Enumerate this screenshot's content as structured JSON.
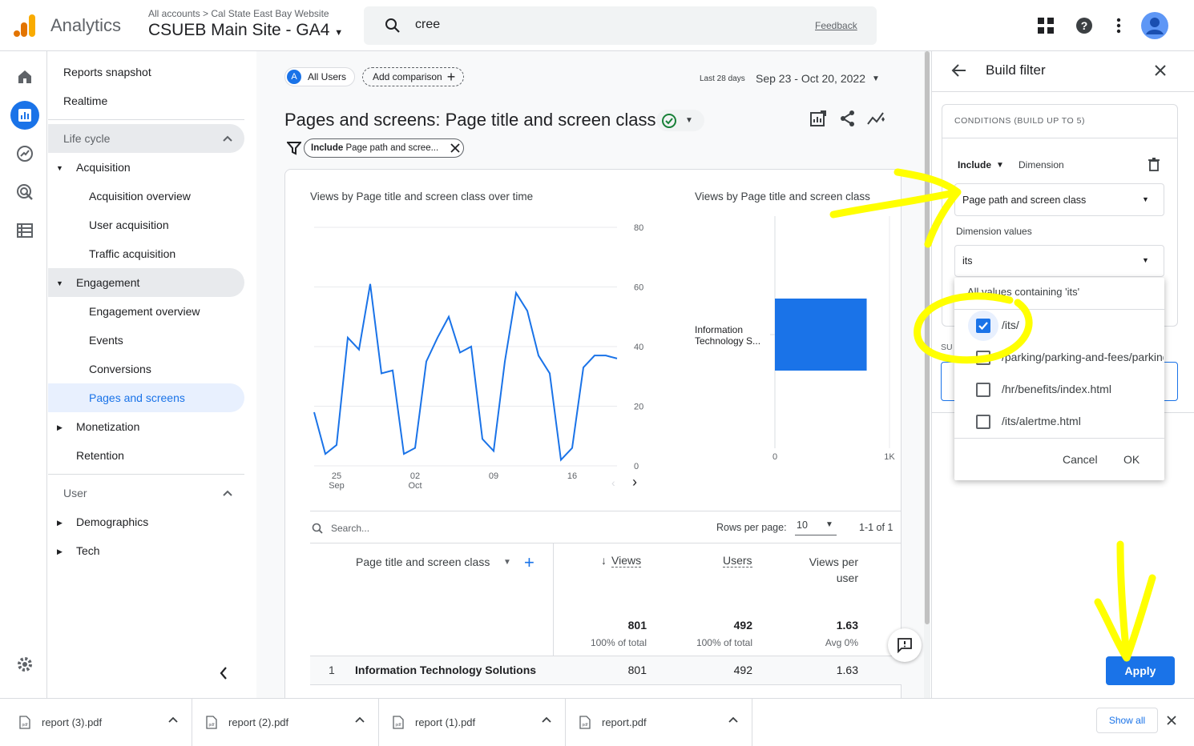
{
  "header": {
    "app_name": "Analytics",
    "breadcrumb_all_accounts": "All accounts",
    "breadcrumb_site": "Cal State East Bay Website",
    "property": "CSUEB Main Site - GA4",
    "search_value": "cree",
    "feedback": "Feedback"
  },
  "nav": {
    "reports_snapshot": "Reports snapshot",
    "realtime": "Realtime",
    "lifecycle": "Life cycle",
    "acquisition": "Acquisition",
    "acquisition_overview": "Acquisition overview",
    "user_acquisition": "User acquisition",
    "traffic_acquisition": "Traffic acquisition",
    "engagement": "Engagement",
    "engagement_overview": "Engagement overview",
    "events": "Events",
    "conversions": "Conversions",
    "pages_and_screens": "Pages and screens",
    "monetization": "Monetization",
    "retention": "Retention",
    "user": "User",
    "demographics": "Demographics",
    "tech": "Tech"
  },
  "main": {
    "segment_letter": "A",
    "segment": "All Users",
    "add_comparison": "Add comparison",
    "date_label": "Last 28 days",
    "date_range": "Sep 23 - Oct 20, 2022",
    "title": "Pages and screens: Page title and screen class",
    "filter_chip_bold": "Include",
    "filter_chip_text": "Page path and scree...",
    "line_chart_title": "Views by Page title and screen class over time",
    "bar_chart_title": "Views by Page title and screen class",
    "bar_label_1": "Information",
    "bar_label_2": "Technology S...",
    "search_placeholder": "Search...",
    "rows_per_page_label": "Rows per page:",
    "rows_per_page_value": "10",
    "pagination": "1-1 of 1",
    "col_dimension": "Page title and screen class",
    "col_views": "Views",
    "col_users": "Users",
    "col_vpu_1": "Views per",
    "col_vpu_2": "user",
    "total_views": "801",
    "total_views_sub": "100% of total",
    "total_users": "492",
    "total_users_sub": "100% of total",
    "total_vpu": "1.63",
    "total_vpu_sub": "Avg 0%",
    "row_index": "1",
    "row_name": "Information Technology Solutions",
    "row_views": "801",
    "row_users": "492",
    "row_vpu": "1.63"
  },
  "chart_data": [
    {
      "type": "line",
      "title": "Views by Page title and screen class over time",
      "x_tick_labels": [
        [
          "25",
          "Sep"
        ],
        [
          "02",
          "Oct"
        ],
        [
          "09",
          ""
        ],
        [
          "16",
          ""
        ]
      ],
      "y_ticks": [
        "0",
        "20",
        "40",
        "60",
        "80"
      ],
      "ylim": [
        0,
        80
      ],
      "series": [
        {
          "values": [
            18,
            4,
            7,
            43,
            39,
            61,
            31,
            32,
            4,
            6,
            35,
            43,
            50,
            38,
            40,
            9,
            5,
            35,
            58,
            52,
            37,
            31,
            2,
            6,
            33,
            37,
            37,
            36
          ]
        }
      ],
      "color": "#1a73e8",
      "grid": true
    },
    {
      "type": "bar",
      "title": "Views by Page title and screen class",
      "categories": [
        "Information Technology S..."
      ],
      "values": [
        801
      ],
      "x_tick_labels": [
        "0",
        "1K"
      ],
      "xlim": [
        0,
        1000
      ],
      "orientation": "horizontal",
      "color": "#1a73e8"
    }
  ],
  "panel": {
    "title": "Build filter",
    "conditions_label": "CONDITIONS (BUILD UP TO 5)",
    "include": "Include",
    "dimension_label": "Dimension",
    "dimension_value": "Page path and screen class",
    "dimension_values_label": "Dimension values",
    "dimension_values_value": "its",
    "dropdown_header": "All values containing 'its'",
    "options": [
      {
        "label": "/its/",
        "checked": true
      },
      {
        "label": "/parking/parking-and-fees/parking",
        "checked": false
      },
      {
        "label": "/hr/benefits/index.html",
        "checked": false
      },
      {
        "label": "/its/alertme.html",
        "checked": false
      }
    ],
    "partial_label": "SU",
    "cancel": "Cancel",
    "ok": "OK",
    "apply": "Apply"
  },
  "downloads": {
    "items": [
      "report (3).pdf",
      "report (2).pdf",
      "report (1).pdf",
      "report.pdf"
    ],
    "show_all": "Show all"
  },
  "colors": {
    "accent": "#1a73e8",
    "annotation": "#ffff00",
    "logo_orange": "#f9ab00",
    "logo_dark": "#e37400"
  }
}
